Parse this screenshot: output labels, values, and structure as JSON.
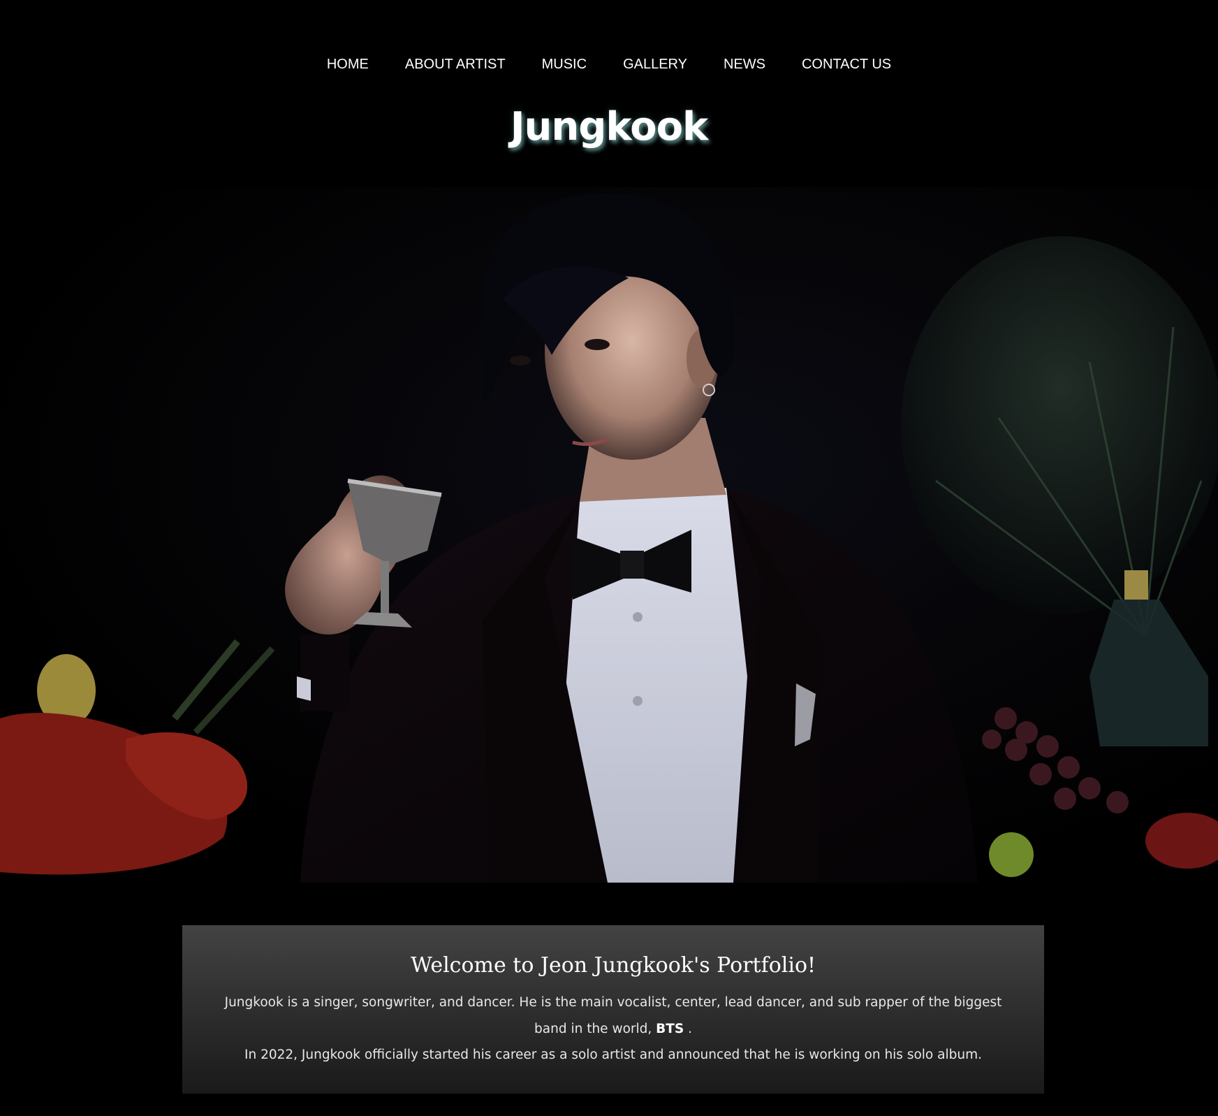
{
  "nav": {
    "items": [
      {
        "label": "HOME",
        "name": "nav-home"
      },
      {
        "label": "ABOUT ARTIST",
        "name": "nav-about-artist"
      },
      {
        "label": "MUSIC",
        "name": "nav-music"
      },
      {
        "label": "GALLERY",
        "name": "nav-gallery"
      },
      {
        "label": "NEWS",
        "name": "nav-news"
      },
      {
        "label": "CONTACT US",
        "name": "nav-contact-us"
      }
    ]
  },
  "header": {
    "title": "Jungkook"
  },
  "hero": {
    "image": "portrait-photo"
  },
  "welcome": {
    "heading": "Welcome to Jeon Jungkook's Portfolio!",
    "intro_before": "Jungkook is a singer, songwriter, and dancer. He is the main vocalist, center, lead dancer, and sub rapper of the biggest band in the world, ",
    "band": "BTS",
    "intro_after": " .",
    "solo_text": "In 2022, Jungkook officially started his career as a solo artist and announced that he is working on his solo album."
  },
  "colors": {
    "background": "#000000",
    "text": "#ffffff",
    "title_glow": "#96dcdc",
    "panel_top": "#434343",
    "panel_bottom": "#1a1a1a"
  }
}
